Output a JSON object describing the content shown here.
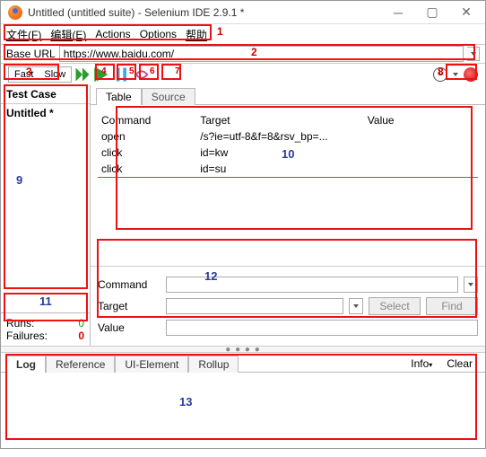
{
  "window": {
    "title": "Untitled (untitled suite) - Selenium IDE 2.9.1 *"
  },
  "menu": {
    "file": "文件(F)",
    "edit": "编辑(E)",
    "actions": "Actions",
    "options": "Options",
    "help": "帮助"
  },
  "baseurl": {
    "label": "Base URL",
    "value": "https://www.baidu.com/"
  },
  "speed": {
    "fast": "Fast",
    "slow": "Slow"
  },
  "sidebar": {
    "header": "Test Case",
    "name": "Untitled *",
    "runs_lbl": "Runs:",
    "runs_val": "0",
    "fail_lbl": "Failures:",
    "fail_val": "0"
  },
  "tabs": {
    "table": "Table",
    "source": "Source"
  },
  "cols": {
    "cmd": "Command",
    "tgt": "Target",
    "val": "Value"
  },
  "rows": [
    {
      "cmd": "open",
      "tgt": "/s?ie=utf-8&f=8&rsv_bp=...",
      "val": ""
    },
    {
      "cmd": "click",
      "tgt": "id=kw",
      "val": ""
    },
    {
      "cmd": "click",
      "tgt": "id=su",
      "val": ""
    }
  ],
  "fields": {
    "cmd": "Command",
    "tgt": "Target",
    "val": "Value",
    "select": "Select",
    "find": "Find"
  },
  "log": {
    "log": "Log",
    "ref": "Reference",
    "ui": "UI-Element",
    "rollup": "Rollup",
    "info": "Info",
    "clear": "Clear"
  },
  "ann": {
    "a1": "1",
    "a2": "2",
    "a3": "3",
    "a4": "4",
    "a5": "5",
    "a6": "6",
    "a7": "7",
    "a8": "8",
    "a9": "9",
    "a10": "10",
    "a11": "11",
    "a12": "12",
    "a13": "13"
  }
}
